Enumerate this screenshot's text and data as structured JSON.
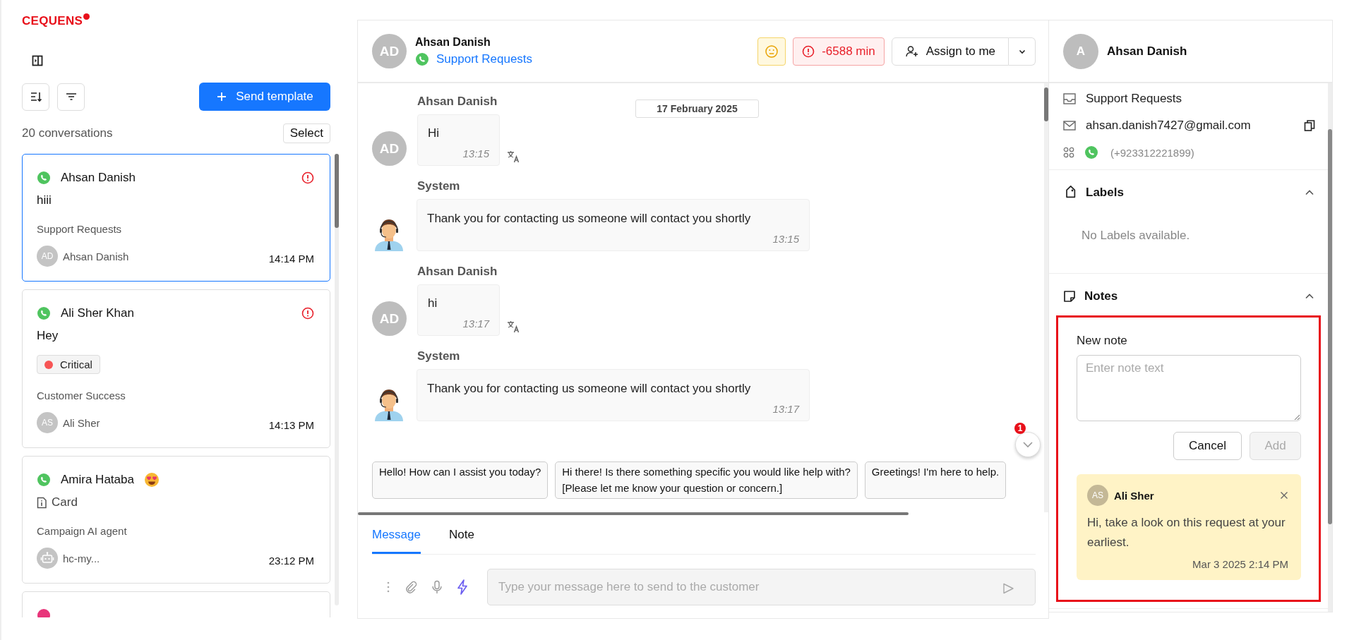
{
  "logo": "CEQUENS",
  "toolbar": {
    "send_template": "Send template",
    "count": "20 conversations",
    "select": "Select"
  },
  "conversations": [
    {
      "kind": "whatsapp",
      "name": "Ahsan Danish",
      "emoji": false,
      "alert": true,
      "preview": {
        "kind": "text",
        "text": "hiii"
      },
      "inbox": "Support Requests",
      "assignee": {
        "kind": "person",
        "initials": "AD",
        "name": "Ahsan Danish"
      },
      "time": "14:14 PM",
      "selected": true
    },
    {
      "kind": "whatsapp",
      "name": "Ali Sher Khan",
      "emoji": false,
      "alert": true,
      "preview": {
        "kind": "text",
        "text": "Hey"
      },
      "tag": {
        "label": "Critical",
        "color": "#f75555"
      },
      "inbox": "Customer Success",
      "assignee": {
        "kind": "person",
        "initials": "AS",
        "name": "Ali Sher"
      },
      "time": "14:13 PM",
      "selected": false
    },
    {
      "kind": "whatsapp",
      "name": "Amira Hataba",
      "emoji": true,
      "alert": false,
      "preview": {
        "kind": "card",
        "text": "Card"
      },
      "inbox": "Campaign AI agent",
      "assignee": {
        "kind": "bot",
        "name": "hc-my..."
      },
      "time": "23:12 PM",
      "selected": false
    },
    {
      "kind": "other",
      "selected": false
    }
  ],
  "chat": {
    "initials": "AD",
    "name": "Ahsan Danish",
    "inbox": "Support Requests",
    "sla": "-6588 min",
    "assign": "Assign to me",
    "date": "17 February 2025",
    "messages": [
      {
        "kind": "customer",
        "sender": "Ahsan Danish",
        "initials": "AD",
        "text": "Hi",
        "time": "13:15",
        "translate": true
      },
      {
        "kind": "system",
        "sender": "System",
        "text": "Thank you for contacting us someone will contact you shortly",
        "time": "13:15",
        "translate": false
      },
      {
        "kind": "customer",
        "sender": "Ahsan Danish",
        "initials": "AD",
        "text": "hi",
        "time": "13:17",
        "translate": true
      },
      {
        "kind": "system",
        "sender": "System",
        "text": "Thank you for contacting us someone will contact you shortly",
        "time": "13:17",
        "translate": false
      }
    ],
    "suggestions": [
      [
        "Hello! How can I assist you today?"
      ],
      [
        "Hi there! Is there something specific you would like help with?",
        "[Please let me know your question or concern.]"
      ],
      [
        "Greetings! I'm here to help."
      ]
    ],
    "unread": "1",
    "tabs": [
      {
        "label": "Message",
        "selected": true
      },
      {
        "label": "Note",
        "selected": false
      }
    ],
    "composer": {
      "placeholder": "Type your message here to send to the customer"
    }
  },
  "contact": {
    "initial": "A",
    "name": "Ahsan Danish",
    "inbox": "Support Requests",
    "email": "ahsan.danish7427@gmail.com",
    "phone": "(+923312221899)"
  },
  "labels": {
    "title": "Labels",
    "expanded": true,
    "empty": "No Labels available."
  },
  "notes": {
    "title": "Notes",
    "expanded": true,
    "new_label": "New note",
    "placeholder": "Enter note text",
    "cancel": "Cancel",
    "add": "Add",
    "add_disabled": true,
    "items": [
      {
        "initials": "AS",
        "author": "Ali Sher",
        "text": "Hi, take a look on this request at your earliest.",
        "date": "Mar 3 2025 2:14 PM"
      }
    ]
  }
}
